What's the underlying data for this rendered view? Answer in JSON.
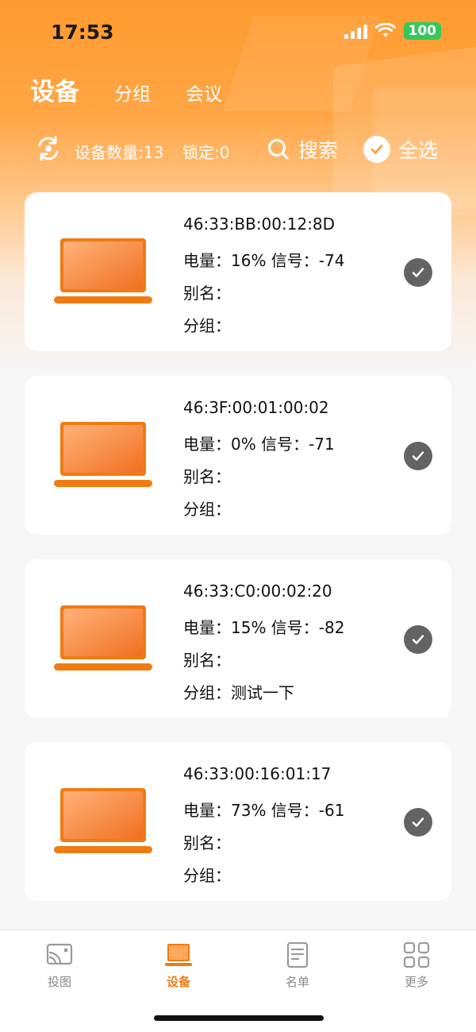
{
  "status_bar": {
    "time": "17:53",
    "battery": "100"
  },
  "top_tabs": [
    {
      "label": "设备",
      "active": true
    },
    {
      "label": "分组",
      "active": false
    },
    {
      "label": "会议",
      "active": false
    }
  ],
  "toolbar": {
    "device_count": "设备数量:13",
    "lock_count": "锁定:0",
    "search_label": "搜索",
    "select_all_label": "全选"
  },
  "devices": [
    {
      "mac": "46:33:BB:00:12:8D",
      "power_signal": "电量：16% 信号：-74",
      "alias": "别名：",
      "group": "分组："
    },
    {
      "mac": "46:3F:00:01:00:02",
      "power_signal": "电量：0% 信号：-71",
      "alias": "别名：",
      "group": "分组："
    },
    {
      "mac": "46:33:C0:00:02:20",
      "power_signal": "电量：15% 信号：-82",
      "alias": "别名：",
      "group": "分组：测试一下"
    },
    {
      "mac": "46:33:00:16:01:17",
      "power_signal": "电量：73% 信号：-61",
      "alias": "别名：",
      "group": "分组："
    }
  ],
  "bottom_nav": [
    {
      "label": "投图",
      "icon": "cast-icon",
      "active": false
    },
    {
      "label": "设备",
      "icon": "laptop-icon",
      "active": true
    },
    {
      "label": "名单",
      "icon": "document-icon",
      "active": false
    },
    {
      "label": "更多",
      "icon": "grid-icon",
      "active": false
    }
  ],
  "colors": {
    "accent": "#ef7c12",
    "check_gray": "#636363"
  }
}
